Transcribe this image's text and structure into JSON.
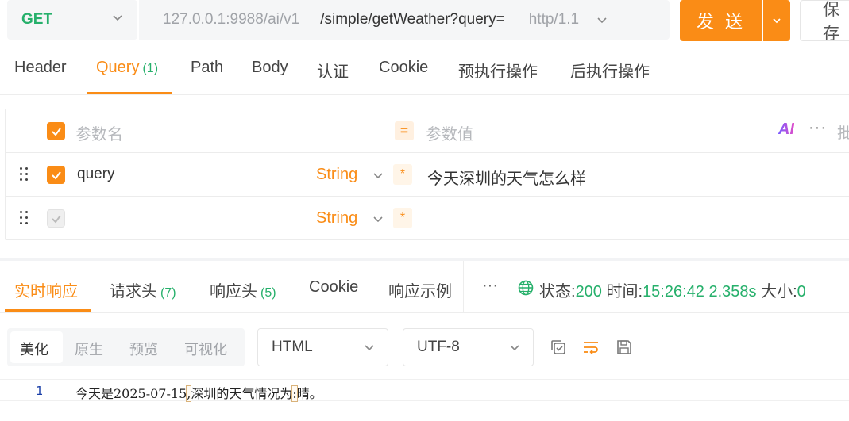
{
  "request": {
    "method": "GET",
    "url_base": "127.0.0.1:9988/ai/v1",
    "url_path": "/simple/getWeather?query=",
    "protocol": "http/1.1",
    "send_label": "发 送",
    "save_label": "保存"
  },
  "request_tabs": [
    {
      "label": "Header",
      "count": ""
    },
    {
      "label": "Query",
      "count": "(1)"
    },
    {
      "label": "Path",
      "count": ""
    },
    {
      "label": "Body",
      "count": ""
    },
    {
      "label": "认证",
      "count": ""
    },
    {
      "label": "Cookie",
      "count": ""
    },
    {
      "label": "预执行操作",
      "count": ""
    },
    {
      "label": "后执行操作",
      "count": ""
    }
  ],
  "params": {
    "header": {
      "name_placeholder": "参数名",
      "value_placeholder": "参数值",
      "ai_label": "AI",
      "more": "···",
      "bulk_label": "批"
    },
    "rows": [
      {
        "name": "query",
        "type": "String",
        "required": "*",
        "value": "今天深圳的天气怎么样",
        "checked": true
      },
      {
        "name": "",
        "type": "String",
        "required": "*",
        "value": "",
        "checked": false
      }
    ]
  },
  "response_tabs": [
    {
      "label": "实时响应",
      "count": ""
    },
    {
      "label": "请求头",
      "count": "(7)"
    },
    {
      "label": "响应头",
      "count": "(5)"
    },
    {
      "label": "Cookie",
      "count": ""
    },
    {
      "label": "响应示例",
      "count": ""
    }
  ],
  "response_status": {
    "more": "···",
    "status_label": "状态:",
    "status_code": "200",
    "time_label": "时间:",
    "time_value": "15:26:42",
    "duration": "2.358s",
    "size_label": "大小:",
    "size_value": "0"
  },
  "response_view": {
    "modes": [
      "美化",
      "原生",
      "预览",
      "可视化"
    ],
    "format": "HTML",
    "encoding": "UTF-8"
  },
  "response_body": {
    "line_number": "1",
    "part1": "今天是2025-07-15",
    "punct1": ",",
    "part2": "深圳的天气情况为",
    "punct2": ":",
    "part3": "晴。"
  },
  "colors": {
    "accent": "#fa8c16",
    "success": "#26b06b"
  }
}
